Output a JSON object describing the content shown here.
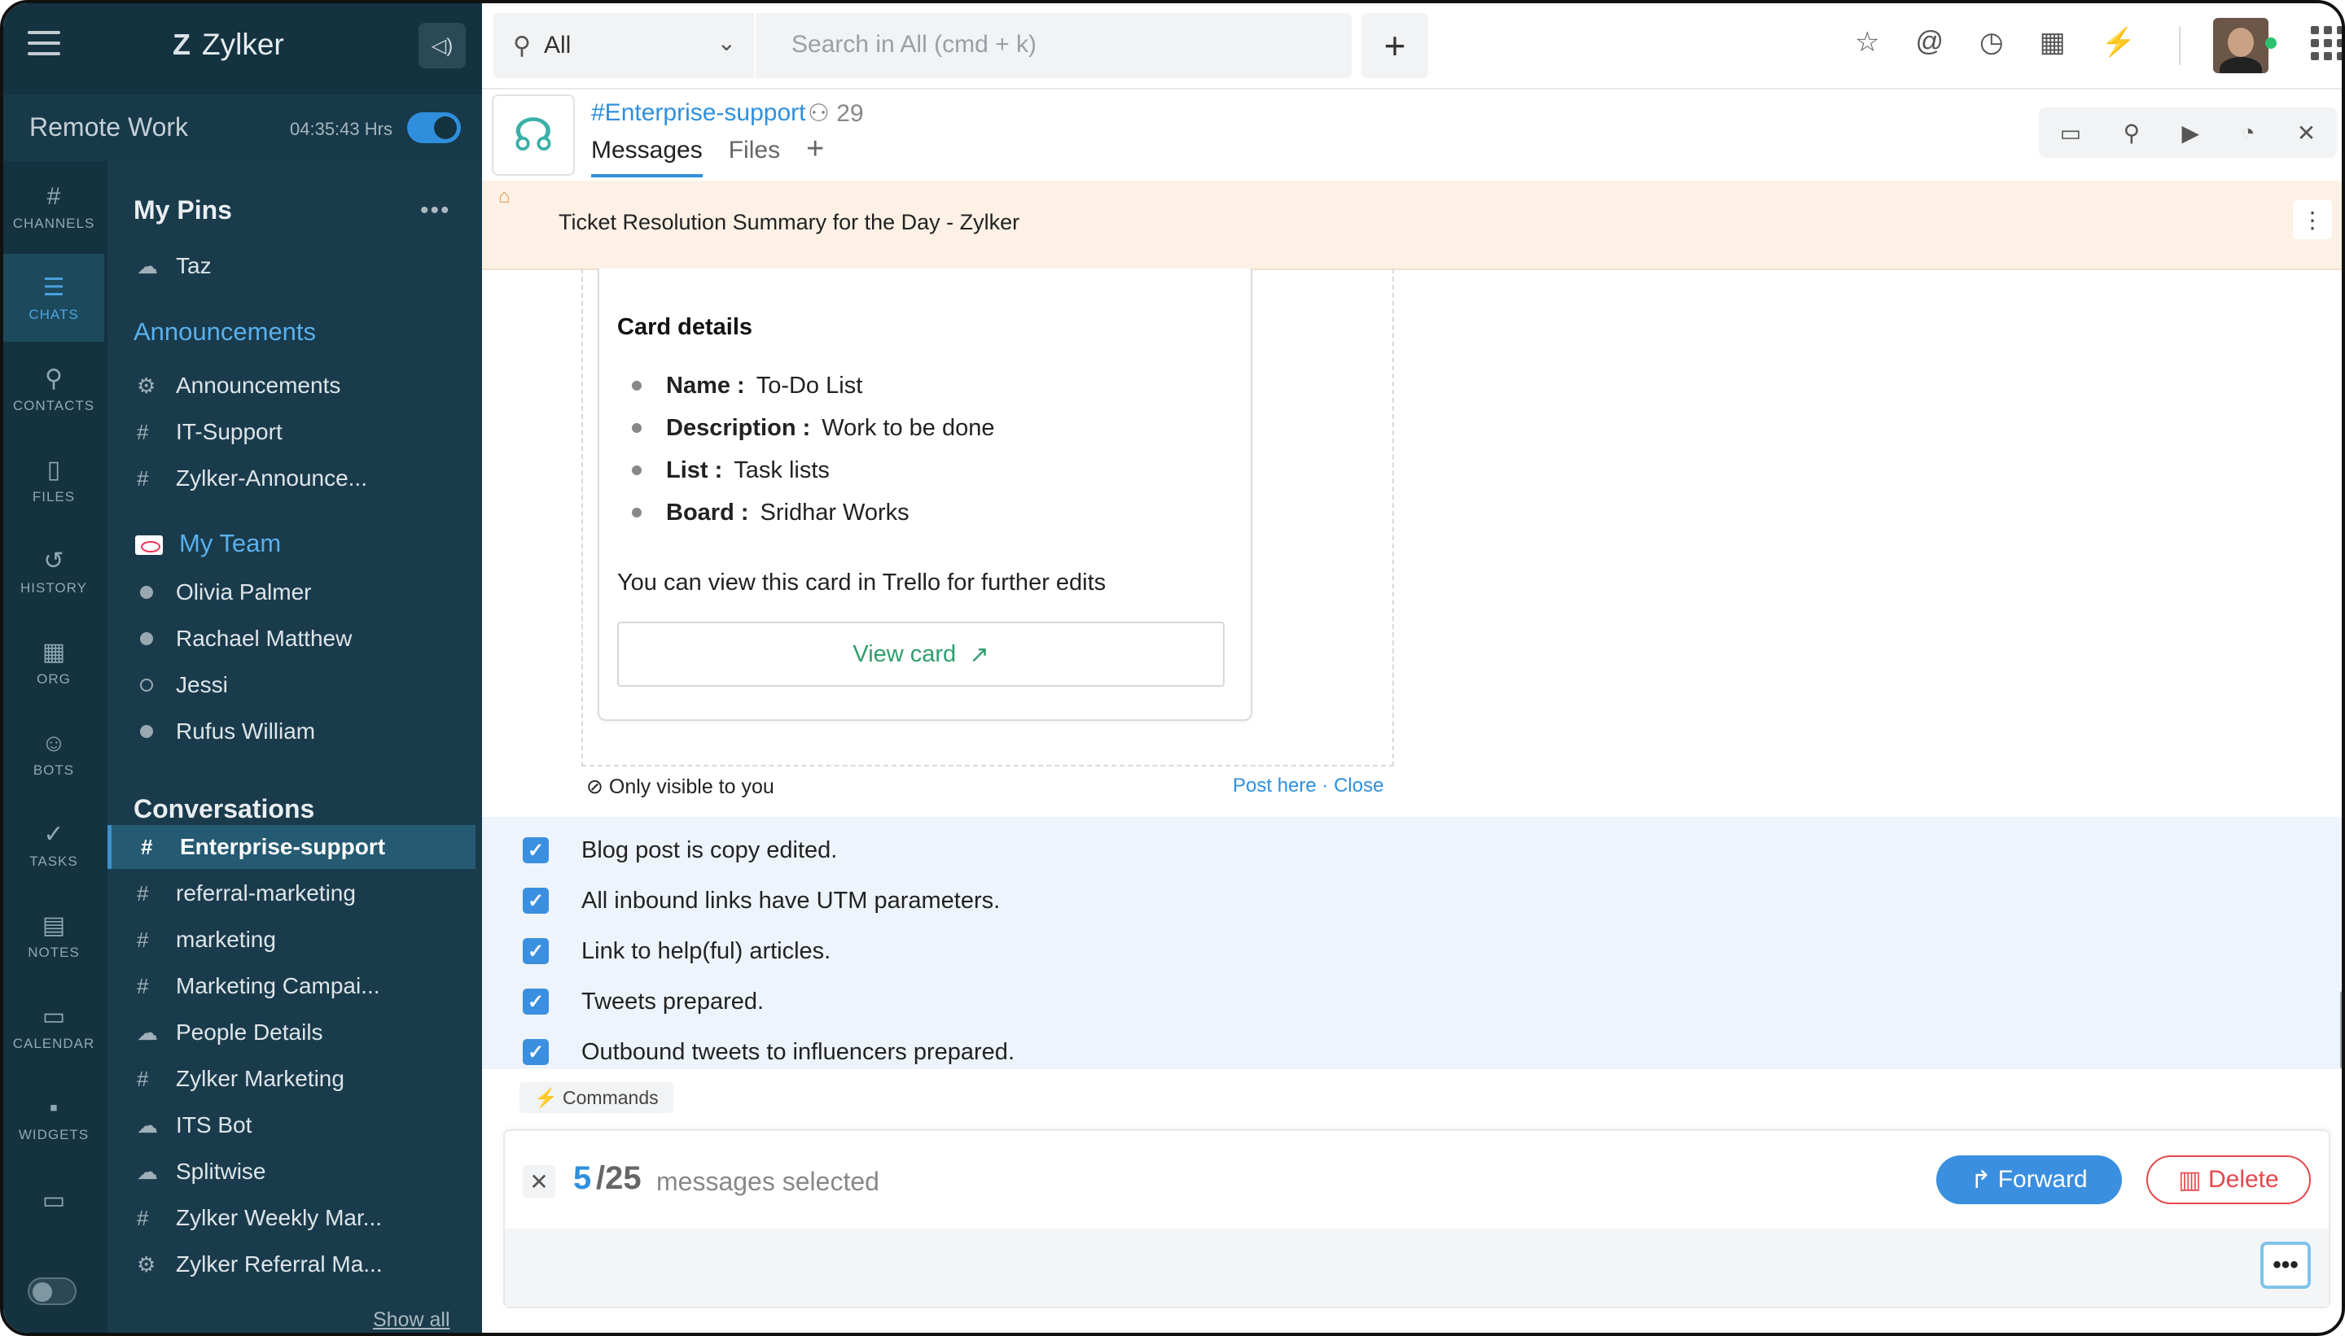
{
  "app": {
    "name": "Zylker"
  },
  "workspace": {
    "name": "Remote Work",
    "timer": "04:35:43 Hrs"
  },
  "rail": [
    {
      "label": "CHANNELS",
      "glyph": "#"
    },
    {
      "label": "CHATS",
      "glyph": "☰"
    },
    {
      "label": "CONTACTS",
      "glyph": "⚲"
    },
    {
      "label": "FILES",
      "glyph": "▯"
    },
    {
      "label": "HISTORY",
      "glyph": "↺"
    },
    {
      "label": "ORG",
      "glyph": "▦"
    },
    {
      "label": "BOTS",
      "glyph": "☺"
    },
    {
      "label": "TASKS",
      "glyph": "✓"
    },
    {
      "label": "NOTES",
      "glyph": "▤"
    },
    {
      "label": "CALENDAR",
      "glyph": "▭"
    },
    {
      "label": "WIDGETS",
      "glyph": "▪"
    }
  ],
  "sidebar": {
    "pins_title": "My Pins",
    "pins": [
      {
        "label": "Taz",
        "pfx": "☁"
      }
    ],
    "announcements_title": "Announcements",
    "announcements": [
      {
        "label": "Announcements",
        "pfx": "⚙"
      },
      {
        "label": "IT-Support",
        "pfx": "#"
      },
      {
        "label": "Zylker-Announce...",
        "pfx": "#"
      }
    ],
    "team_title": "My Team",
    "team": [
      {
        "label": "Olivia Palmer"
      },
      {
        "label": "Rachael Matthew"
      },
      {
        "label": "Jessi"
      },
      {
        "label": "Rufus William"
      }
    ],
    "conversations_title": "Conversations",
    "conversations": [
      {
        "label": "Enterprise-support",
        "pfx": "#"
      },
      {
        "label": "referral-marketing",
        "pfx": "#"
      },
      {
        "label": "marketing",
        "pfx": "#"
      },
      {
        "label": "Marketing Campai...",
        "pfx": "#"
      },
      {
        "label": "People Details",
        "pfx": "☁"
      },
      {
        "label": "Zylker Marketing",
        "pfx": "#"
      },
      {
        "label": "ITS Bot",
        "pfx": "☁"
      },
      {
        "label": "Splitwise",
        "pfx": "☁"
      },
      {
        "label": "Zylker Weekly Mar...",
        "pfx": "#"
      },
      {
        "label": "Zylker Referral Ma...",
        "pfx": "⚙"
      }
    ],
    "show_all": "Show all"
  },
  "search": {
    "scope": "All",
    "placeholder": "Search in All (cmd + k)"
  },
  "channel": {
    "name": "#Enterprise-support",
    "members": "29",
    "tabs": [
      "Messages",
      "Files"
    ]
  },
  "pinned": {
    "text": "Ticket Resolution Summary for the Day - Zylker"
  },
  "card": {
    "title": "Card details",
    "fields": [
      {
        "label": "Name :",
        "value": "To-Do List"
      },
      {
        "label": "Description :",
        "value": "Work to be done"
      },
      {
        "label": "List :",
        "value": "Task lists"
      },
      {
        "label": "Board :",
        "value": "Sridhar Works"
      }
    ],
    "note": "You can view this card in Trello for further edits",
    "button": "View card"
  },
  "visibility": {
    "text": "Only visible to you",
    "post": "Post here",
    "close": "Close"
  },
  "checklist": [
    "Blog post is copy edited.",
    "All inbound links have UTM parameters.",
    "Link to help(ful) articles.",
    "Tweets prepared.",
    "Outbound tweets to influencers prepared."
  ],
  "commands": "Commands",
  "selection": {
    "selected": "5",
    "total": "/25",
    "text": "messages selected",
    "forward": "Forward",
    "delete": "Delete"
  }
}
